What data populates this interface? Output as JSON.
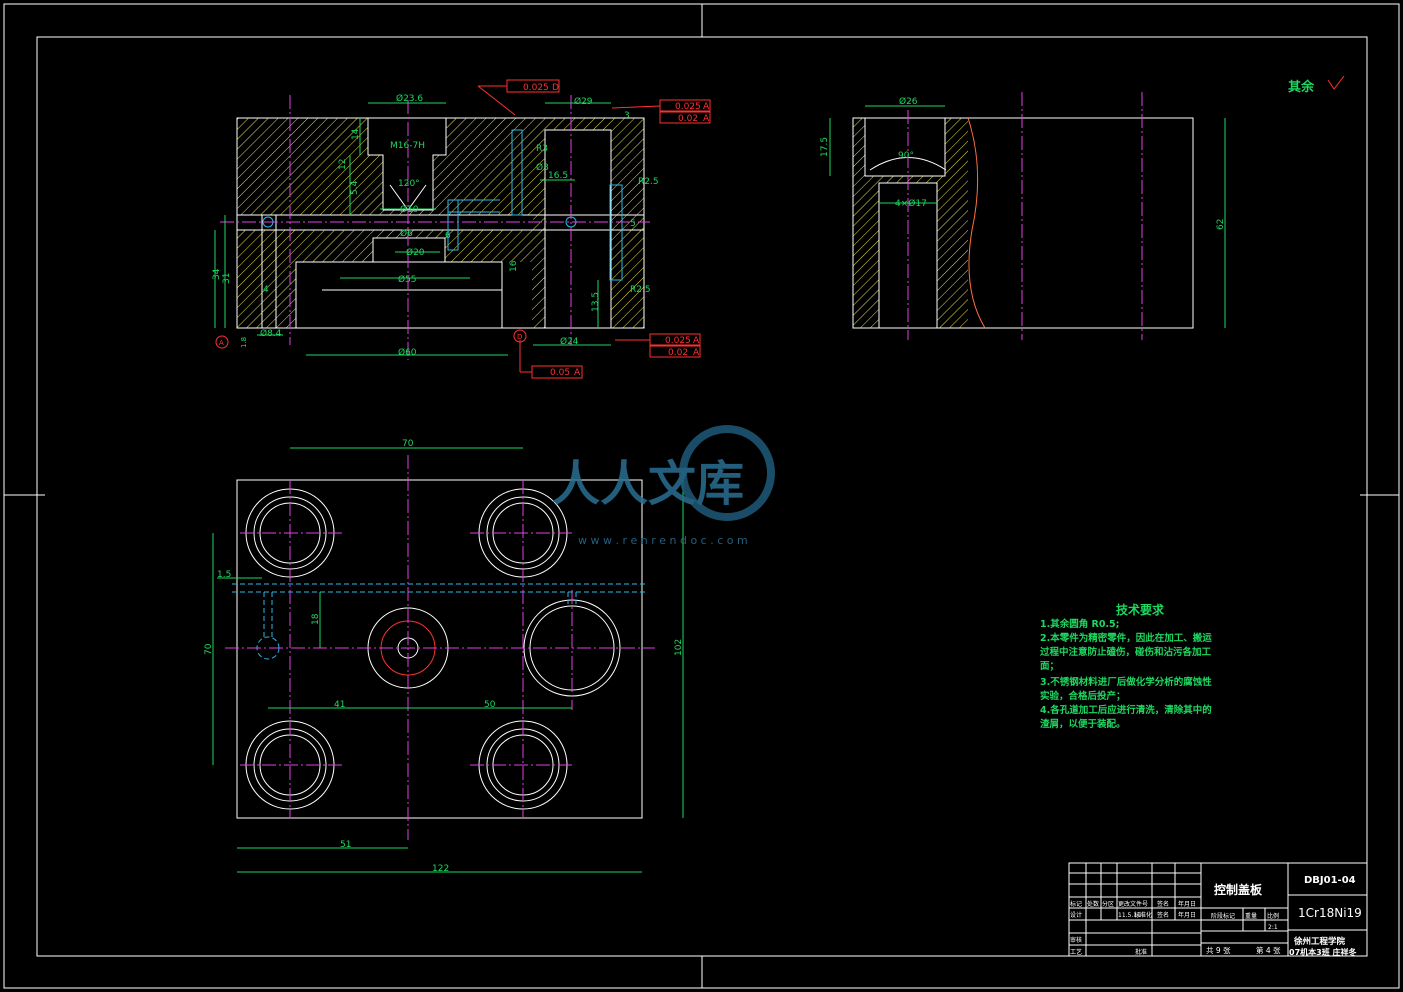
{
  "watermark": {
    "title": "人人文库",
    "url": "w w w . r e n r e n d o c . c o m"
  },
  "roughness_note": {
    "label": "其余"
  },
  "tech_requirements": {
    "title": "技术要求",
    "items": [
      "1.其余圆角  R0.5;",
      "2.本零件为精密零件，因此在加工、搬运",
      "过程中注意防止磕伤，碰伤和沾污各加工",
      "面；",
      "3.不锈钢材料进厂后做化学分析的腐蚀性",
      "实验，合格后投产；",
      "4.各孔道加工后应进行清洗，清除其中的",
      "渣屑，以便于装配。"
    ]
  },
  "title_block": {
    "part_name": "控制盖板",
    "drawing_no": "DBJ01-04",
    "material": "1Cr18Ni19",
    "school": "徐州工程学院",
    "class_author": "07机本3班 庄祥冬",
    "scale": "2:1",
    "sheet_total": "共 9 张",
    "sheet_no": "第 4 张",
    "header_cells": [
      "标记",
      "处数",
      "分区",
      "更改文件号",
      "签名",
      "年月日"
    ],
    "row_design": [
      "设计",
      "",
      "11.5.10",
      "标准化",
      "",
      "签名",
      "年月日"
    ],
    "row_check": "审核",
    "row_process": "工艺",
    "row_approve": "批准",
    "stage_label": "阶段标记",
    "weight_label": "重量",
    "scale_label": "比例"
  },
  "dims_top": {
    "d236": "Ø23.6",
    "d29": "Ø29",
    "m16": "M16-7H",
    "ang120": "120°",
    "d3": "Ø3",
    "r3": "R3",
    "v165": "16.5",
    "d10": "Ø10",
    "d6": "Ø6",
    "d20": "Ø20",
    "d55": "Ø55",
    "d60": "Ø60",
    "d24": "Ø24",
    "d84": "Ø8.4",
    "r25a": "R2.5",
    "r25b": "R2.5",
    "v34": "34",
    "v31": "31",
    "v14": "14",
    "v12": "12",
    "v54": "5.4",
    "v135": "13.5",
    "v4": "4",
    "v16": "16",
    "v6": "6",
    "v3": "3",
    "v5": "5",
    "v18": "1.8",
    "tol1": "0.025",
    "tol1d": "D",
    "tol2": "0.025",
    "tol2d": "A",
    "tol3": "0.02",
    "tol3d": "A",
    "tol4": "0.025",
    "tol4d": "A",
    "tol5": "0.02",
    "tol5d": "A",
    "tol6": "0.05",
    "tol6d": "A",
    "datumA": "A",
    "datumD": "D"
  },
  "dims_side": {
    "d26": "Ø26",
    "v175": "17.5",
    "ang90": "90°",
    "holes": "4×Ø17",
    "v62": "62"
  },
  "dims_plan": {
    "w70": "70",
    "h70": "70",
    "v15": "1.5",
    "v18": "18",
    "v41": "41",
    "v50": "50",
    "v102": "102",
    "v51": "51",
    "v122": "122"
  }
}
